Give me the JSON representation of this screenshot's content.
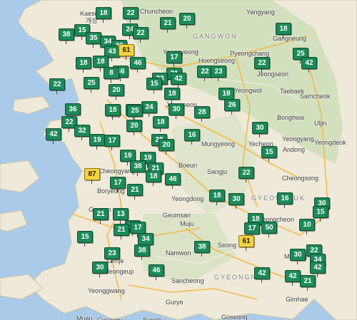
{
  "colors": {
    "sea": "#a9cbe9",
    "land": "#eee9d8",
    "forest": "#b9d6a7",
    "good": "#1d8a59",
    "moderate": "#f6d33e"
  },
  "place_labels": [
    {
      "text": "Kaeso",
      "kind": "city"
    },
    {
      "text": "개성",
      "kind": "city"
    },
    {
      "text": "Chuncheon",
      "kind": "city"
    },
    {
      "text": "Yangyang",
      "kind": "city"
    },
    {
      "text": "GANGWON",
      "kind": "region"
    },
    {
      "text": "Gangneung",
      "kind": "city"
    },
    {
      "text": "Pyeongchang",
      "kind": "city"
    },
    {
      "text": "Hoengseong",
      "kind": "city"
    },
    {
      "text": "Jeongseon",
      "kind": "city"
    },
    {
      "text": "Yeongwol",
      "kind": "city"
    },
    {
      "text": "Samcheok",
      "kind": "city"
    },
    {
      "text": "Taebaek",
      "kind": "city"
    },
    {
      "text": "Bonghwa",
      "kind": "city"
    },
    {
      "text": "Uljin",
      "kind": "city"
    },
    {
      "text": "Yeongyang",
      "kind": "city"
    },
    {
      "text": "Yecheon",
      "kind": "city"
    },
    {
      "text": "Andong",
      "kind": "city"
    },
    {
      "text": "Yeongdeok",
      "kind": "city"
    },
    {
      "text": "Cheongsong",
      "kind": "city"
    },
    {
      "text": "Mungyeong",
      "kind": "city"
    },
    {
      "text": "Cheongyang",
      "kind": "city"
    },
    {
      "text": "Boeun",
      "kind": "city"
    },
    {
      "text": "Sangju",
      "kind": "city"
    },
    {
      "text": "Boryeong",
      "kind": "city"
    },
    {
      "text": "Yeongdong",
      "kind": "city"
    },
    {
      "text": "Geumsan",
      "kind": "city"
    },
    {
      "text": "Gunsan",
      "kind": "city"
    },
    {
      "text": "Muju",
      "kind": "city"
    },
    {
      "text": "Gimje",
      "kind": "city"
    },
    {
      "text": "Jeongeup",
      "kind": "city"
    },
    {
      "text": "Namwon",
      "kind": "city"
    },
    {
      "text": "Miryang",
      "kind": "city"
    },
    {
      "text": "Yeonggwang",
      "kind": "city"
    },
    {
      "text": "Sancheong",
      "kind": "city"
    },
    {
      "text": "GYEONGNAM",
      "kind": "region"
    },
    {
      "text": "Gwangju",
      "kind": "city"
    },
    {
      "text": "Guryo",
      "kind": "city"
    },
    {
      "text": "Gimhae",
      "kind": "city"
    },
    {
      "text": "Muan",
      "kind": "city"
    },
    {
      "text": "Sunch",
      "kind": "city"
    },
    {
      "text": "Goseong",
      "kind": "city"
    },
    {
      "text": "Yeongcheon",
      "kind": "city"
    },
    {
      "text": "GYEONGBUK",
      "kind": "region"
    },
    {
      "text": "Seong",
      "kind": "city"
    },
    {
      "text": "Hwa",
      "kind": "city"
    },
    {
      "text": "Jeongseon",
      "kind": "city"
    },
    {
      "text": "Yangpyeong",
      "kind": "city"
    }
  ],
  "aqi_markers": [
    {
      "value": 18,
      "level": "good"
    },
    {
      "value": 22,
      "level": "good"
    },
    {
      "value": 20,
      "level": "good"
    },
    {
      "value": 21,
      "level": "good"
    },
    {
      "value": 38,
      "level": "good"
    },
    {
      "value": 15,
      "level": "good"
    },
    {
      "value": 35,
      "level": "good"
    },
    {
      "value": 24,
      "level": "good"
    },
    {
      "value": 34,
      "level": "good"
    },
    {
      "value": 28,
      "level": "good"
    },
    {
      "value": 43,
      "level": "good"
    },
    {
      "value": 61,
      "level": "moderate"
    },
    {
      "value": 22,
      "level": "good"
    },
    {
      "value": 17,
      "level": "good"
    },
    {
      "value": 18,
      "level": "good"
    },
    {
      "value": 25,
      "level": "good"
    },
    {
      "value": 22,
      "level": "good"
    },
    {
      "value": 42,
      "level": "good"
    },
    {
      "value": 46,
      "level": "good"
    },
    {
      "value": 46,
      "level": "good"
    },
    {
      "value": 22,
      "level": "good"
    },
    {
      "value": 23,
      "level": "good"
    },
    {
      "value": 18,
      "level": "good"
    },
    {
      "value": 18,
      "level": "good"
    },
    {
      "value": 25,
      "level": "good"
    },
    {
      "value": 22,
      "level": "good"
    },
    {
      "value": 8,
      "level": "good"
    },
    {
      "value": 21,
      "level": "good"
    },
    {
      "value": 33,
      "level": "good"
    },
    {
      "value": 42,
      "level": "good"
    },
    {
      "value": 15,
      "level": "good"
    },
    {
      "value": 18,
      "level": "good"
    },
    {
      "value": 26,
      "level": "good"
    },
    {
      "value": 20,
      "level": "good"
    },
    {
      "value": 18,
      "level": "good"
    },
    {
      "value": 36,
      "level": "good"
    },
    {
      "value": 24,
      "level": "good"
    },
    {
      "value": 22,
      "level": "good"
    },
    {
      "value": 28,
      "level": "good"
    },
    {
      "value": 30,
      "level": "good"
    },
    {
      "value": 25,
      "level": "good"
    },
    {
      "value": 18,
      "level": "good"
    },
    {
      "value": 22,
      "level": "good"
    },
    {
      "value": 32,
      "level": "good"
    },
    {
      "value": 42,
      "level": "good"
    },
    {
      "value": 20,
      "level": "good"
    },
    {
      "value": 18,
      "level": "good"
    },
    {
      "value": 30,
      "level": "good"
    },
    {
      "value": 16,
      "level": "good"
    },
    {
      "value": 19,
      "level": "good"
    },
    {
      "value": 28,
      "level": "good"
    },
    {
      "value": 17,
      "level": "good"
    },
    {
      "value": 20,
      "level": "good"
    },
    {
      "value": 19,
      "level": "good"
    },
    {
      "value": 19,
      "level": "good"
    },
    {
      "value": 15,
      "level": "good"
    },
    {
      "value": 38,
      "level": "good"
    },
    {
      "value": 21,
      "level": "good"
    },
    {
      "value": 22,
      "level": "good"
    },
    {
      "value": 87,
      "level": "moderate"
    },
    {
      "value": 18,
      "level": "good"
    },
    {
      "value": 17,
      "level": "good"
    },
    {
      "value": 46,
      "level": "good"
    },
    {
      "value": 21,
      "level": "good"
    },
    {
      "value": 18,
      "level": "good"
    },
    {
      "value": 30,
      "level": "good"
    },
    {
      "value": 16,
      "level": "good"
    },
    {
      "value": 30,
      "level": "good"
    },
    {
      "value": 15,
      "level": "good"
    },
    {
      "value": 10,
      "level": "good"
    },
    {
      "value": 21,
      "level": "good"
    },
    {
      "value": 13,
      "level": "good"
    },
    {
      "value": 18,
      "level": "good"
    },
    {
      "value": 21,
      "level": "good"
    },
    {
      "value": 50,
      "level": "good"
    },
    {
      "value": 17,
      "level": "good"
    },
    {
      "value": 17,
      "level": "good"
    },
    {
      "value": 21,
      "level": "good"
    },
    {
      "value": 34,
      "level": "good"
    },
    {
      "value": 15,
      "level": "good"
    },
    {
      "value": 61,
      "level": "moderate"
    },
    {
      "value": 38,
      "level": "good"
    },
    {
      "value": 38,
      "level": "good"
    },
    {
      "value": 23,
      "level": "good"
    },
    {
      "value": 22,
      "level": "good"
    },
    {
      "value": 30,
      "level": "good"
    },
    {
      "value": 34,
      "level": "good"
    },
    {
      "value": 30,
      "level": "good"
    },
    {
      "value": 42,
      "level": "good"
    },
    {
      "value": 46,
      "level": "good"
    },
    {
      "value": 42,
      "level": "good"
    },
    {
      "value": 42,
      "level": "good"
    },
    {
      "value": 21,
      "level": "good"
    }
  ]
}
